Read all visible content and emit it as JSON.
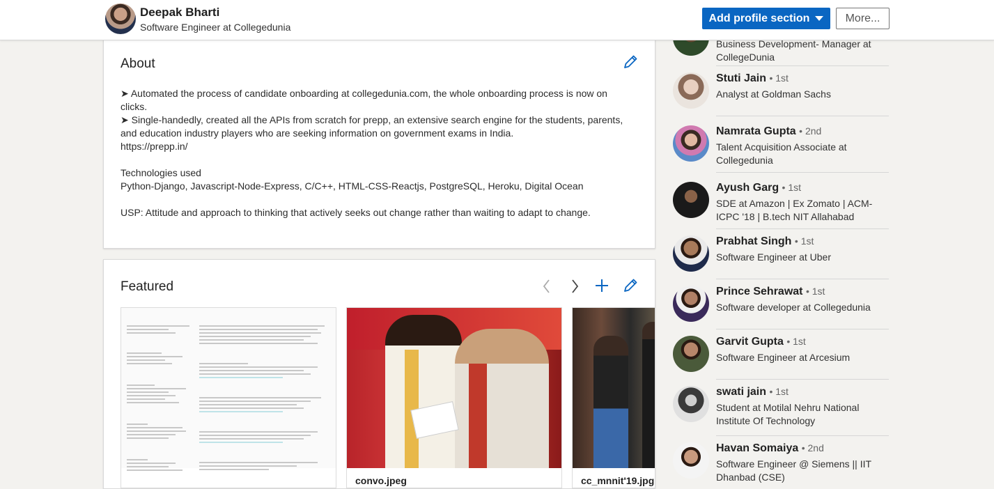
{
  "profile_bar": {
    "name": "Deepak Bharti",
    "headline": "Software Engineer at Collegedunia",
    "add_section_label": "Add profile section",
    "more_label": "More...",
    "accent": "#0a66c2"
  },
  "about": {
    "title": "About",
    "edit_icon": "pencil-icon",
    "paragraphs": [
      "➤ Automated the process of candidate onboarding at collegedunia.com, the whole onboarding process is now on clicks.",
      "➤ Single-handedly, created all the APIs from scratch for prepp, an extensive search engine for the students, parents, and education industry players who are seeking information on government exams in India.",
      "https://prepp.in/",
      "",
      "Technologies used",
      "Python-Django, Javascript-Node-Express, C/C++, HTML-CSS-Reactjs, PostgreSQL, Heroku, Digital Ocean",
      "",
      "USP: Attitude and approach to thinking that actively seeks out change rather than waiting to adapt to change."
    ]
  },
  "featured": {
    "title": "Featured",
    "icons": [
      "chevron-left-icon",
      "chevron-right-icon",
      "plus-icon",
      "pencil-icon"
    ],
    "items": [
      {
        "caption": ""
      },
      {
        "caption": "convo.jpeg"
      },
      {
        "caption": "cc_mnnit'19.jpg"
      }
    ]
  },
  "people_also_viewed": [
    {
      "name": "",
      "degree": "",
      "title": "Business Development- Manager at CollegeDunia"
    },
    {
      "name": "Stuti Jain",
      "degree": "• 1st",
      "title": "Analyst at Goldman Sachs"
    },
    {
      "name": "Namrata Gupta",
      "degree": "• 2nd",
      "title": "Talent Acquisition Associate at Collegedunia"
    },
    {
      "name": "Ayush Garg",
      "degree": "• 1st",
      "title": "SDE at Amazon | Ex Zomato | ACM-ICPC '18 | B.tech NIT Allahabad"
    },
    {
      "name": "Prabhat Singh",
      "degree": "• 1st",
      "title": "Software Engineer at Uber"
    },
    {
      "name": "Prince Sehrawat",
      "degree": "• 1st",
      "title": "Software developer at Collegedunia"
    },
    {
      "name": "Garvit Gupta",
      "degree": "• 1st",
      "title": "Software Engineer at Arcesium"
    },
    {
      "name": "swati jain",
      "degree": "• 1st",
      "title": "Student at Motilal Nehru National Institute Of Technology"
    },
    {
      "name": "Havan Somaiya",
      "degree": "• 2nd",
      "title": "Software Engineer @ Siemens || IIT Dhanbad (CSE)"
    }
  ]
}
